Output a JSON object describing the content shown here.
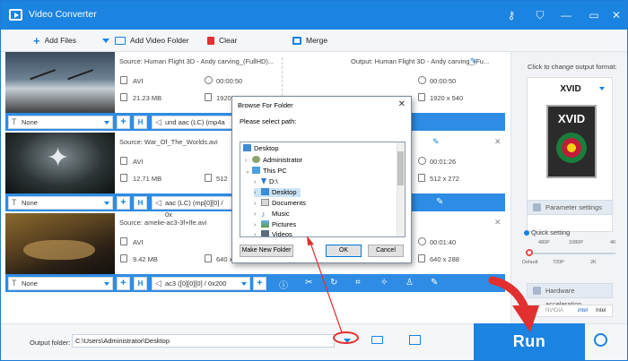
{
  "window": {
    "title": "Video Converter"
  },
  "toolbar": {
    "add_files": "Add Files",
    "add_video_folder": "Add Video Folder",
    "clear": "Clear",
    "merge": "Merge"
  },
  "items": [
    {
      "source": "Source: Human Flight 3D - Andy carving_(FullHD)...",
      "output": "Output: Human Flight 3D - Andy carving_(Fu...",
      "src_format": "AVI",
      "src_duration": "00:00:50",
      "src_size": "21.23 MB",
      "src_res": "1920",
      "out_duration": "00:00:50",
      "out_res": "1920 x 540",
      "subtitle": "None",
      "audio": "und aac (LC) (mp4a"
    },
    {
      "source": "Source: War_Of_The_Worlds.avi",
      "output": "",
      "src_format": "AVI",
      "src_duration": "",
      "src_size": "12.71 MB",
      "src_res": "512",
      "out_duration": "00:01:26",
      "out_res": "512 x 272",
      "subtitle": "None",
      "audio": "aac (LC) (mp[0][0] / 0x"
    },
    {
      "source": "Source: amelie-ac3-3f+lfe.avi",
      "output": "",
      "src_format": "AVI",
      "src_duration": "",
      "src_size": "9.42 MB",
      "src_res": "640 x",
      "out_duration": "00:01:40",
      "out_res": "640 x 288",
      "subtitle": "None",
      "audio": "ac3 ([0][0][0] / 0x200"
    }
  ],
  "right_panel": {
    "header": "Click to change output format:",
    "format": "XVID",
    "thumb_text": "XVID",
    "parameter_settings": "Parameter settings",
    "quick_setting": "Quick setting",
    "ticks_top": [
      "480P",
      "1080P",
      "4K"
    ],
    "ticks_bottom": [
      "Default",
      "720P",
      "2K"
    ],
    "quick_level": 0.0,
    "hardware_acceleration": "Hardware acceleration",
    "hw_nvidia": "NVIDIA",
    "hw_intel": "Intel"
  },
  "dialog": {
    "title": "Browse For Folder",
    "prompt": "Please select path:",
    "tree": [
      {
        "label": "Desktop"
      },
      {
        "label": "Administrator"
      },
      {
        "label": "This PC"
      },
      {
        "label": "D:\\"
      },
      {
        "label": "Desktop"
      },
      {
        "label": "Documents"
      },
      {
        "label": "Music"
      },
      {
        "label": "Pictures"
      },
      {
        "label": "Videos"
      }
    ],
    "make_new_folder": "Make New Folder",
    "ok": "OK",
    "cancel": "Cancel"
  },
  "bottom": {
    "output_folder_label": "Output folder:",
    "output_folder_value": "C:\\Users\\Administrator\\Desktop",
    "run": "Run"
  },
  "colors": {
    "accent": "#1b83e0",
    "annotation": "#e23030"
  }
}
